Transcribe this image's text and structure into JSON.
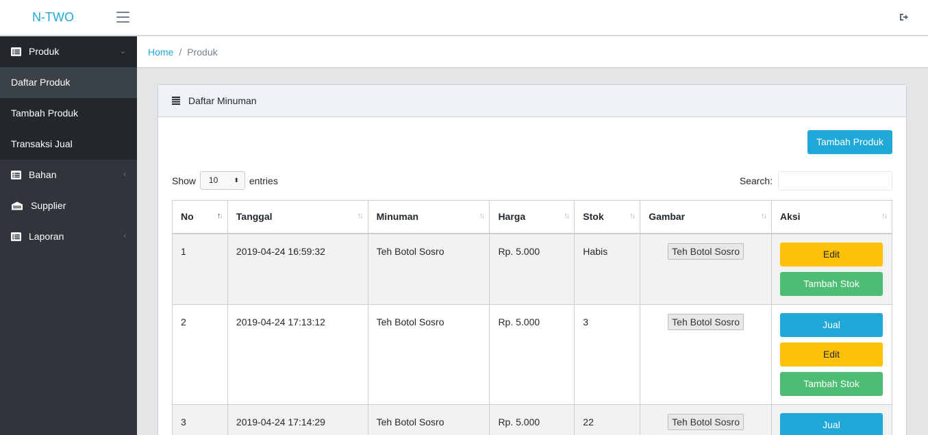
{
  "header": {
    "brand": "N-TWO"
  },
  "sidebar": {
    "items": [
      {
        "label": "Produk",
        "caret": "⌄"
      },
      {
        "label": "Daftar Produk"
      },
      {
        "label": "Tambah Produk"
      },
      {
        "label": "Transaksi Jual"
      },
      {
        "label": "Bahan",
        "caret": "‹"
      },
      {
        "label": "Supplier"
      },
      {
        "label": "Laporan",
        "caret": "‹"
      }
    ]
  },
  "breadcrumb": {
    "home": "Home",
    "sep": "/",
    "current": "Produk"
  },
  "card": {
    "title": "Daftar Minuman",
    "add_button": "Tambah Produk",
    "show_label": "Show",
    "entries_value": "10",
    "entries_label": "entries",
    "search_label": "Search:",
    "search_value": ""
  },
  "table": {
    "columns": [
      "No",
      "Tanggal",
      "Minuman",
      "Harga",
      "Stok",
      "Gambar",
      "Aksi"
    ],
    "rows": [
      {
        "no": "1",
        "tanggal": "2019-04-24 16:59:32",
        "minuman": "Teh Botol Sosro",
        "harga": "Rp. 5.000",
        "stok": "Habis",
        "gambar": "Teh Botol Sosro"
      },
      {
        "no": "2",
        "tanggal": "2019-04-24 17:13:12",
        "minuman": "Teh Botol Sosro",
        "harga": "Rp. 5.000",
        "stok": "3",
        "gambar": "Teh Botol Sosro"
      },
      {
        "no": "3",
        "tanggal": "2019-04-24 17:14:29",
        "minuman": "Teh Botol Sosro",
        "harga": "Rp. 5.000",
        "stok": "22",
        "gambar": "Teh Botol Sosro"
      }
    ],
    "actions": {
      "jual": "Jual",
      "edit": "Edit",
      "tambah_stok": "Tambah Stok"
    },
    "sort_glyph": "↑↓"
  },
  "colors": {
    "primary": "#20a8d8",
    "warning": "#ffc107",
    "success": "#4dbd74",
    "sidebar": "#2f353a"
  },
  "icons": [
    "hamburger-icon",
    "logout-icon",
    "list-icon",
    "building-icon",
    "sort-icon"
  ]
}
